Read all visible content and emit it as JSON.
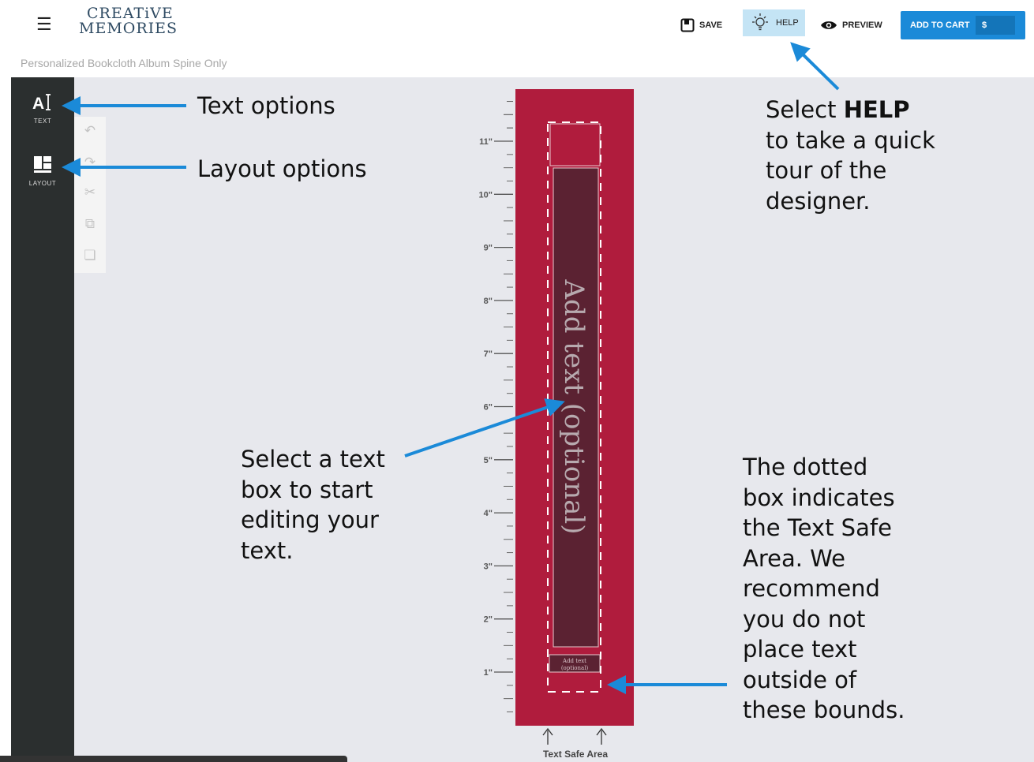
{
  "header": {
    "logo_line1": "CREATiVE",
    "logo_line2": "MEMORIES",
    "save_label": "SAVE",
    "help_label": "HELP",
    "preview_label": "PREVIEW",
    "add_to_cart_label": "ADD TO CART",
    "price_label": "$"
  },
  "subheader": {
    "title": "Personalized Bookcloth Album Spine Only"
  },
  "sidebar": {
    "items": [
      {
        "label": "TEXT",
        "icon": "text-icon"
      },
      {
        "label": "LAYOUT",
        "icon": "layout-icon"
      }
    ]
  },
  "tools": [
    "undo-icon",
    "redo-icon",
    "cut-icon",
    "copy-icon",
    "paste-icon"
  ],
  "spine": {
    "main_placeholder": "Add text (optional)",
    "small_placeholder_line1": "Add text",
    "small_placeholder_line2": "(optional)",
    "color": "#b01c3d",
    "ruler_labels": [
      "11\"",
      "10\"",
      "9\"",
      "8\"",
      "7\"",
      "6\"",
      "5\"",
      "4\"",
      "3\"",
      "2\"",
      "1\""
    ],
    "safe_area_label": "Text Safe Area"
  },
  "annotations": {
    "text_options": "Text options",
    "layout_options": "Layout options",
    "help_line1_pre": "Select ",
    "help_line1_bold": "HELP",
    "help_line2": "to take a quick",
    "help_line3": "tour of the",
    "help_line4": "designer.",
    "select_line1": "Select a text",
    "select_line2": "box to start",
    "select_line3": "editing your",
    "select_line4": "text.",
    "dotted_lines": [
      "The dotted",
      "box indicates",
      "the Text Safe",
      "Area. We",
      "recommend",
      "you do not",
      "place text",
      "outside of",
      "these bounds."
    ]
  },
  "accent_color": "#1b8ad8"
}
